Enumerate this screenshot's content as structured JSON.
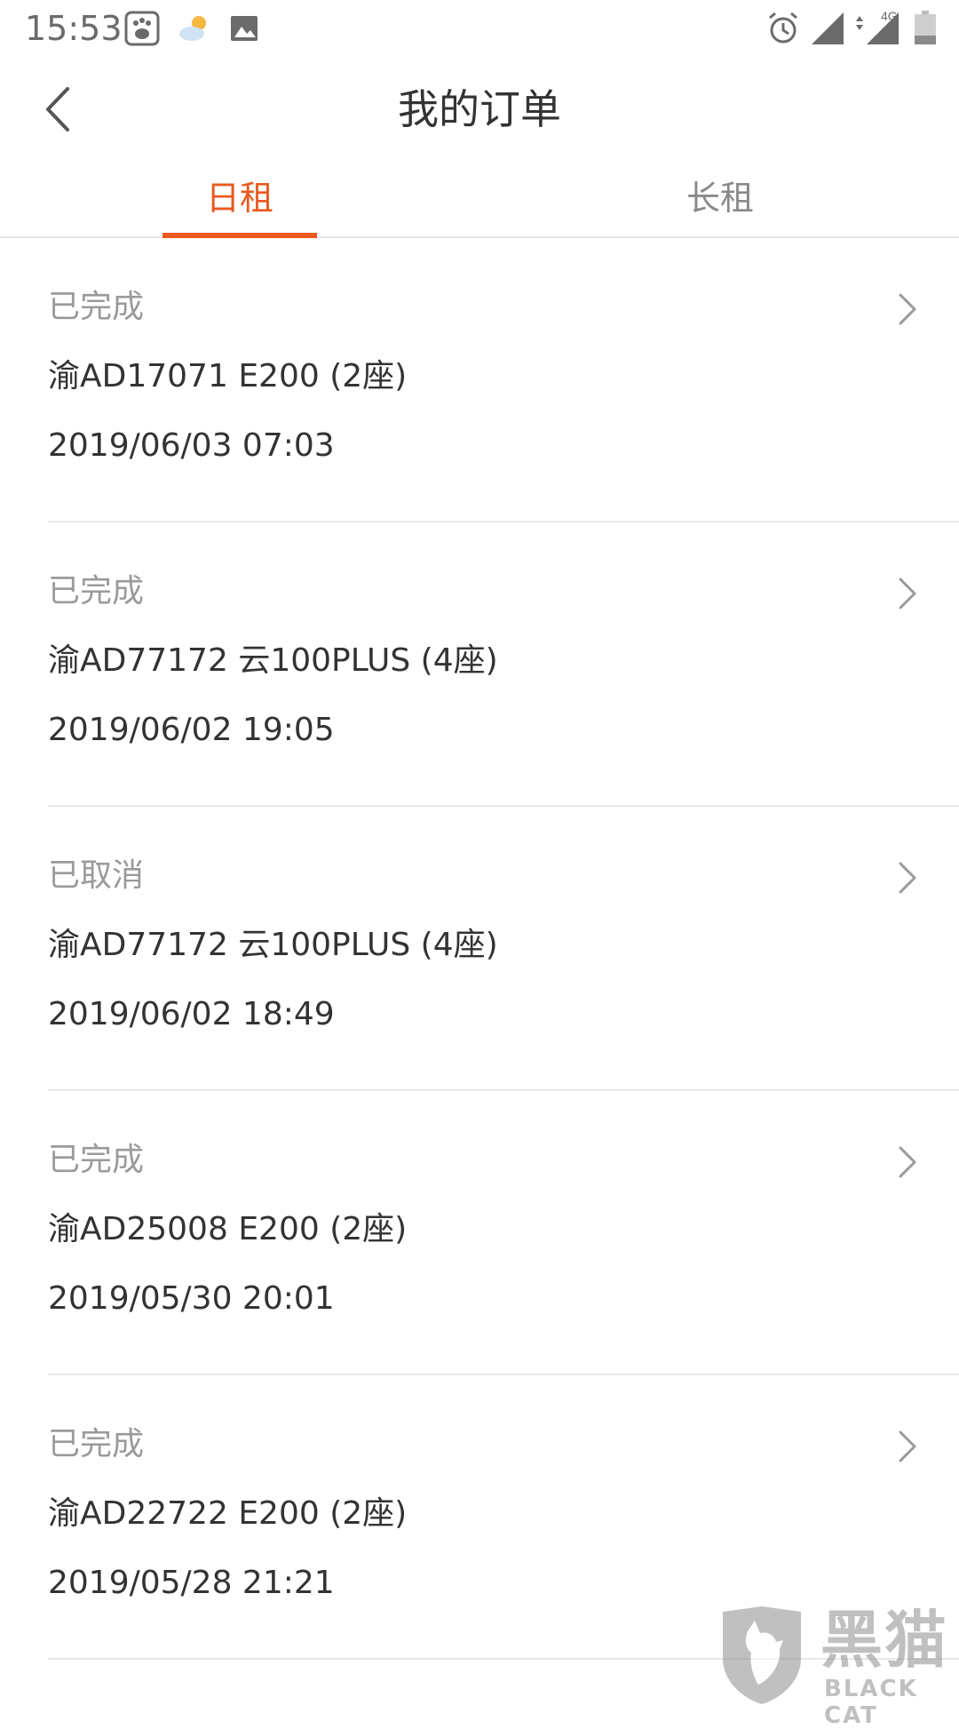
{
  "status_bar": {
    "time": "15:53",
    "icons": [
      "baidu-icon",
      "weather-icon",
      "gallery-icon",
      "alarm-icon",
      "signal-icon",
      "signal-4g-icon",
      "battery-icon"
    ],
    "network_label": "4G"
  },
  "header": {
    "title": "我的订单"
  },
  "tabs": [
    {
      "label": "日租",
      "active": true
    },
    {
      "label": "长租",
      "active": false
    }
  ],
  "orders": [
    {
      "status": "已完成",
      "car": "渝AD17071 E200 (2座)",
      "time": "2019/06/03 07:03"
    },
    {
      "status": "已完成",
      "car": "渝AD77172 云100PLUS (4座)",
      "time": "2019/06/02 19:05"
    },
    {
      "status": "已取消",
      "car": "渝AD77172 云100PLUS (4座)",
      "time": "2019/06/02 18:49"
    },
    {
      "status": "已完成",
      "car": "渝AD25008 E200 (2座)",
      "time": "2019/05/30 20:01"
    },
    {
      "status": "已完成",
      "car": "渝AD22722 E200 (2座)",
      "time": "2019/05/28 21:21"
    }
  ],
  "watermark": {
    "text_cn": "黑猫",
    "text_en": "BLACK CAT"
  },
  "colors": {
    "accent": "#ea5a1f",
    "text_primary": "#333333",
    "text_secondary": "#9a9a9a",
    "divider": "#e8e8e8"
  }
}
